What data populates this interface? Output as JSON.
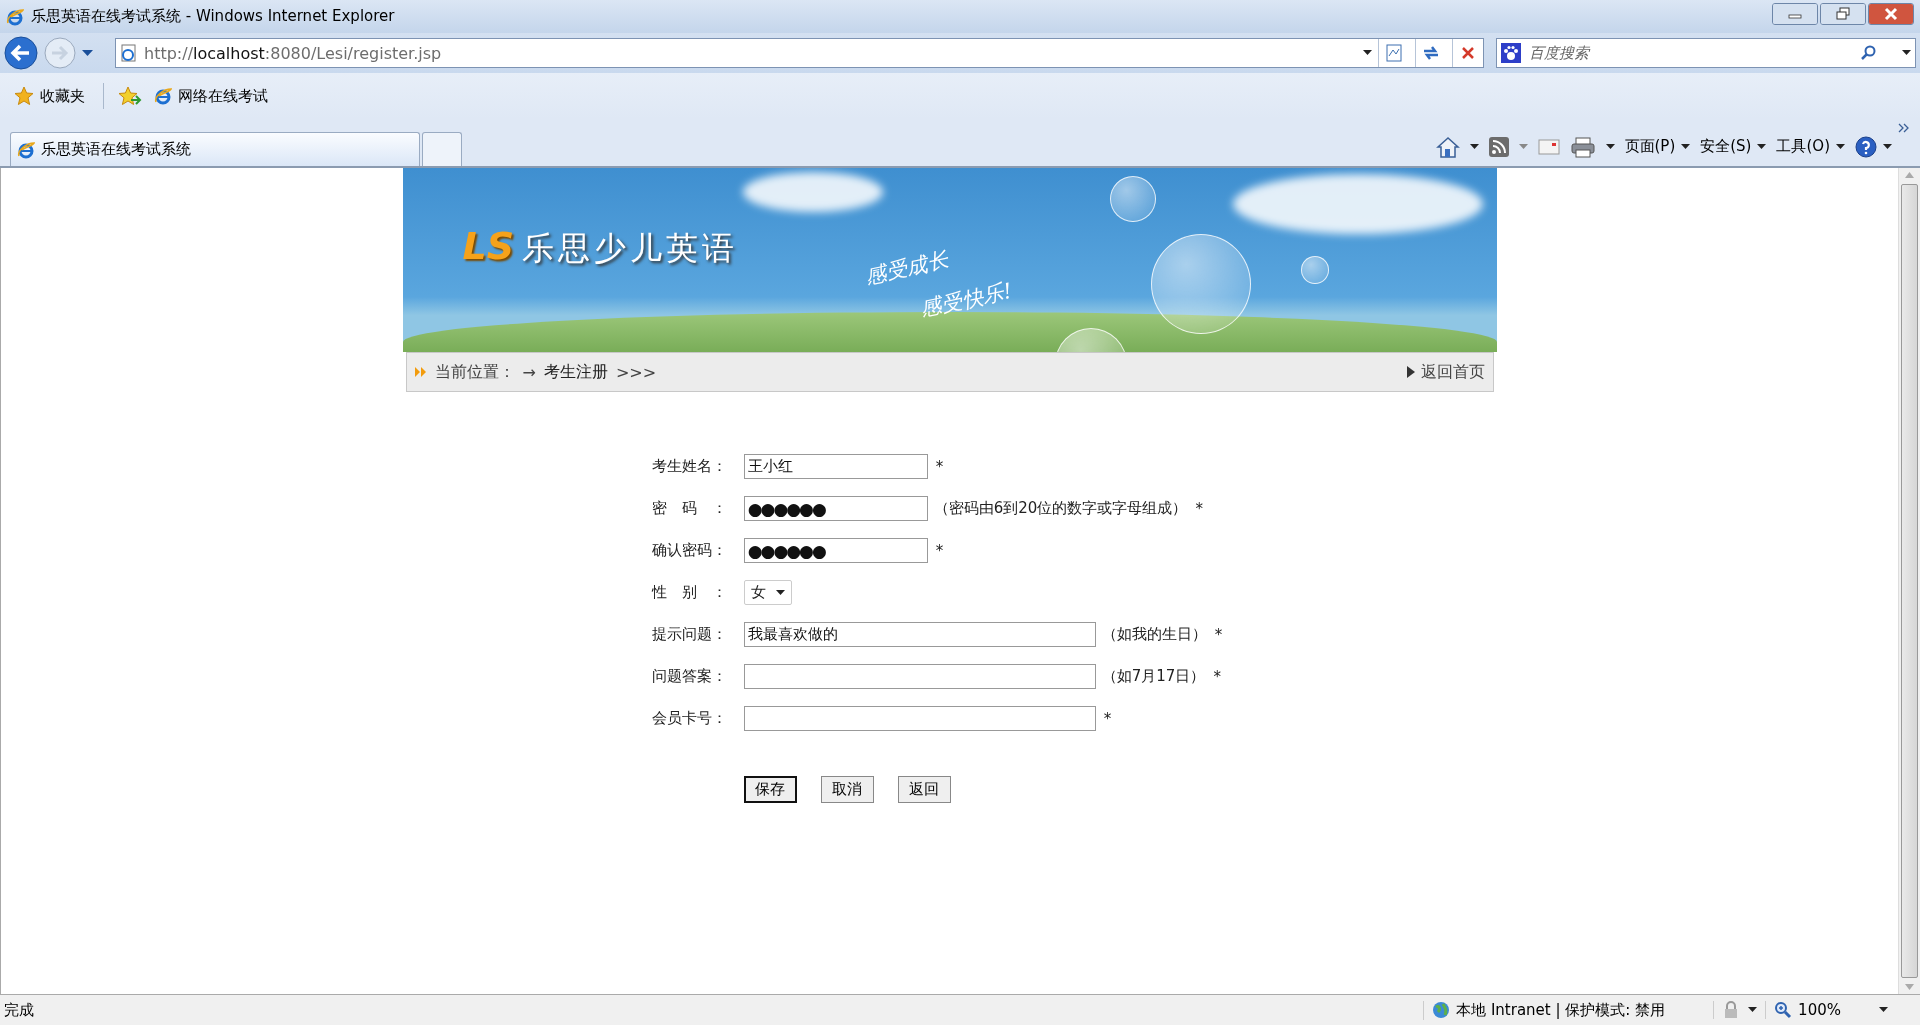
{
  "window": {
    "title": "乐思英语在线考试系统 - Windows Internet Explorer"
  },
  "address_bar": {
    "url": "http://**localhost**:8080/Lesi/register.jsp"
  },
  "search": {
    "placeholder": "百度搜索"
  },
  "favorites_bar": {
    "label": "收藏夹",
    "links": [
      "网络在线考试"
    ]
  },
  "tabs": [
    {
      "label": "乐思英语在线考试系统",
      "selected": true
    }
  ],
  "command_bar": [
    "页面(P)",
    "安全(S)",
    "工具(O)"
  ],
  "banner": {
    "logo_mark": "LS",
    "logo_text": "乐思少儿英语",
    "slogans": [
      "感受成长",
      "感受快乐!"
    ]
  },
  "breadcrumb": {
    "prefix": "当前位置：",
    "separator": "→",
    "current": "考生注册",
    "suffix": ">>>",
    "home_link": "返回首页"
  },
  "form": {
    "fields": [
      {
        "kind": "short",
        "label": "考生姓名：",
        "value": "王小红",
        "required_mark": "*"
      },
      {
        "kind": "masked",
        "label": "密码：",
        "value": "●●●●●●",
        "hint": "（密码由6到20位的数字或字母组成）",
        "required_mark": "*"
      },
      {
        "kind": "masked",
        "label": "确认密码：",
        "value": "●●●●●●",
        "required_mark": "*"
      },
      {
        "kind": "select",
        "label": "性别：",
        "value": "女"
      },
      {
        "kind": "long",
        "label": "提示问题：",
        "value": "我最喜欢做的",
        "hint": "（如我的生日）",
        "required_mark": "*"
      },
      {
        "kind": "long",
        "label": "问题答案：",
        "hint": "（如7月17日）",
        "required_mark": "*"
      },
      {
        "kind": "long",
        "label": "会员卡号：",
        "required_mark": "*"
      }
    ],
    "buttons": [
      {
        "label": "保存",
        "default": true
      },
      {
        "label": "取消",
        "default": false
      },
      {
        "label": "返回",
        "default": false
      }
    ]
  },
  "status_bar": {
    "status": "完成",
    "zone": "本地 Intranet | 保护模式: 禁用",
    "zoom": "100%"
  }
}
